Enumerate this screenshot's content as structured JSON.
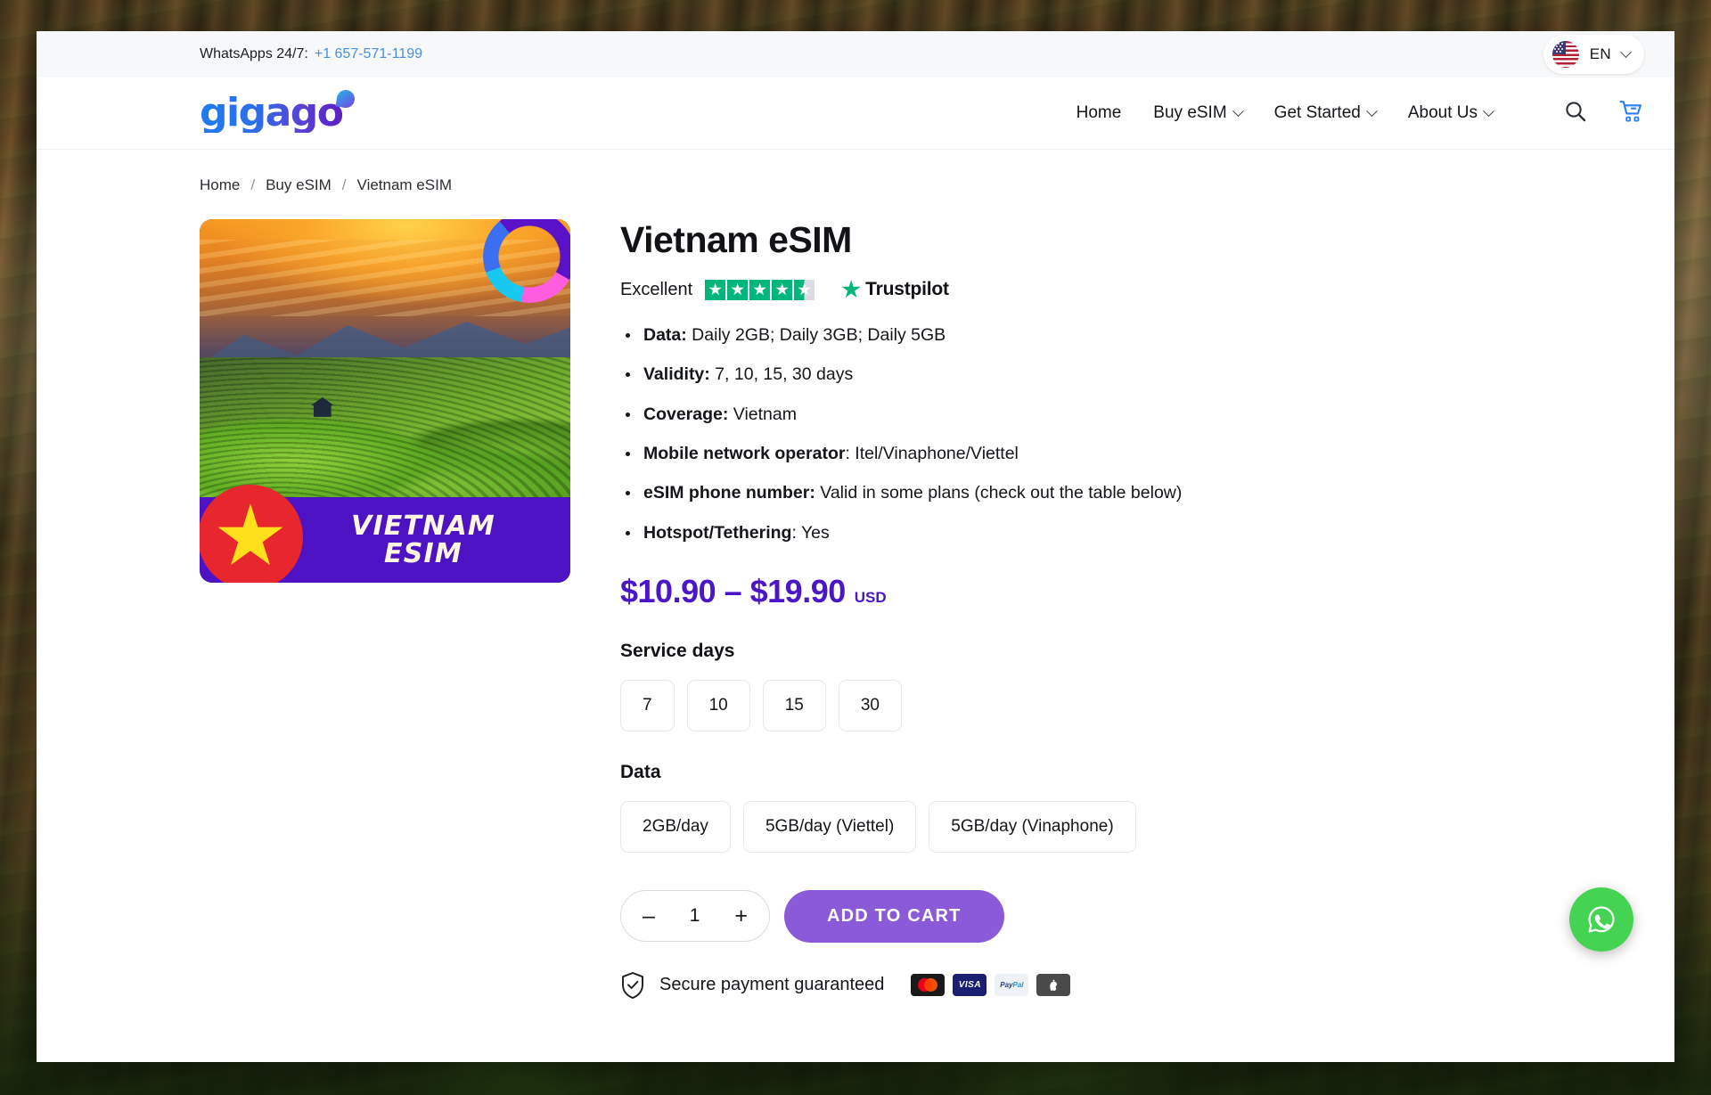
{
  "topbar": {
    "whatsapp_label": "WhatsApps 24/7:",
    "whatsapp_phone": "+1 657-571-1199",
    "language_code": "EN",
    "flag_icon": "us-flag-icon",
    "chevron_icon": "chevron-down-icon"
  },
  "header": {
    "logo_text": "gigago",
    "nav": [
      {
        "label": "Home",
        "has_dropdown": false
      },
      {
        "label": "Buy eSIM",
        "has_dropdown": true
      },
      {
        "label": "Get Started",
        "has_dropdown": true
      },
      {
        "label": "About Us",
        "has_dropdown": true
      }
    ],
    "search_icon": "search-icon",
    "cart_icon": "shopping-cart-icon",
    "cart_color": "#2b7ff0"
  },
  "breadcrumb": {
    "separator": "/",
    "items": [
      "Home",
      "Buy eSIM",
      "Vietnam eSIM"
    ]
  },
  "product": {
    "image": {
      "banner_line1": "VIETNAM",
      "banner_line2": "ESIM",
      "banner_color": "#4d12c4",
      "flag_icon": "vietnam-flag-icon",
      "badge_icon": "gigago-badge-icon"
    },
    "title": "Vietnam eSIM",
    "rating": {
      "word": "Excellent",
      "stars": 4.5,
      "star_color": "#00b67a",
      "brand": "Trustpilot",
      "brand_star_icon": "trustpilot-star-icon"
    },
    "features": [
      {
        "label": "Data:",
        "value": " Daily 2GB; Daily 3GB; Daily 5GB"
      },
      {
        "label": "Validity:",
        "value": " 7, 10, 15, 30 days"
      },
      {
        "label": "Coverage:",
        "value": " Vietnam"
      },
      {
        "label": "Mobile network operator",
        "value": ": Itel/Vinaphone/Viettel"
      },
      {
        "label": "eSIM phone number:",
        "value": " Valid in some plans (check out the table below)"
      },
      {
        "label": "Hotspot/Tethering",
        "value": ": Yes"
      }
    ],
    "price": {
      "range": "$10.90 – $19.90",
      "currency": "USD",
      "color": "#4a16c8"
    },
    "service_days": {
      "label": "Service days",
      "options": [
        "7",
        "10",
        "15",
        "30"
      ]
    },
    "data": {
      "label": "Data",
      "options": [
        "2GB/day",
        "5GB/day (Viettel)",
        "5GB/day (Vinaphone)"
      ]
    },
    "quantity": {
      "decrement": "–",
      "value": "1",
      "increment": "+"
    },
    "add_to_cart": {
      "label": "ADD TO CART",
      "color": "#8b5ad8"
    },
    "secure": {
      "icon": "shield-check-icon",
      "text": "Secure payment guaranteed",
      "methods": [
        "Mastercard",
        "VISA",
        "PayPal",
        "Apple Pay"
      ]
    }
  },
  "floating": {
    "whatsapp_icon": "whatsapp-icon",
    "whatsapp_color": "#45d354"
  }
}
